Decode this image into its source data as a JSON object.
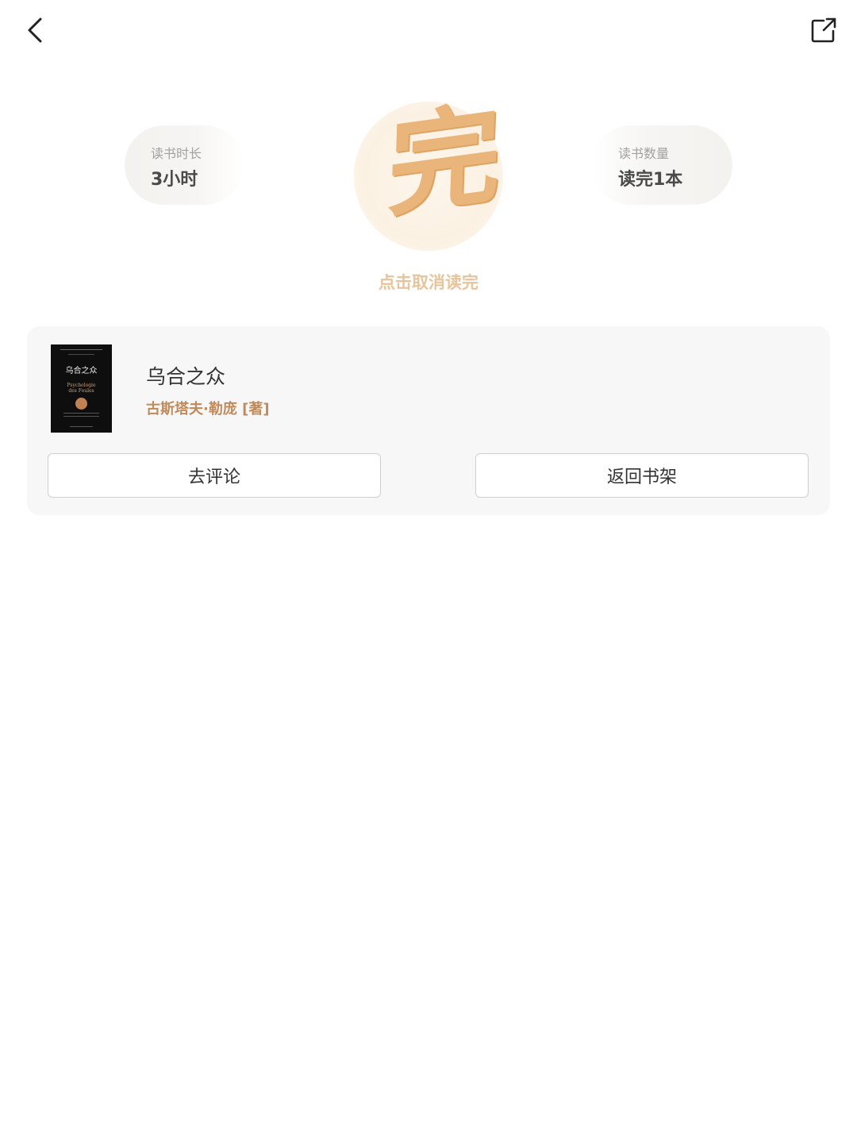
{
  "topbar": {
    "back_icon": "chevron-left-icon",
    "share_icon": "share-external-icon"
  },
  "stats": {
    "left": {
      "label": "读书时长",
      "value": "3小时"
    },
    "right": {
      "label": "读书数量",
      "value": "读完1本"
    }
  },
  "finish": {
    "glyph": "完",
    "cancel_text": "点击取消读完",
    "colors": {
      "glyph": "#e9b57a",
      "cancel_text": "#e6c59c"
    }
  },
  "book": {
    "title": "乌合之众",
    "author": "古斯塔夫·勒庞 [著]",
    "cover": {
      "title": "乌合之众",
      "subtitle": "Psychologie\ndes Foules",
      "background": "#0e0e0e"
    }
  },
  "actions": {
    "review_label": "去评论",
    "shelf_label": "返回书架"
  },
  "colors": {
    "author": "#c08a5b",
    "text": "#333333",
    "card_bg": "#f7f7f7"
  }
}
